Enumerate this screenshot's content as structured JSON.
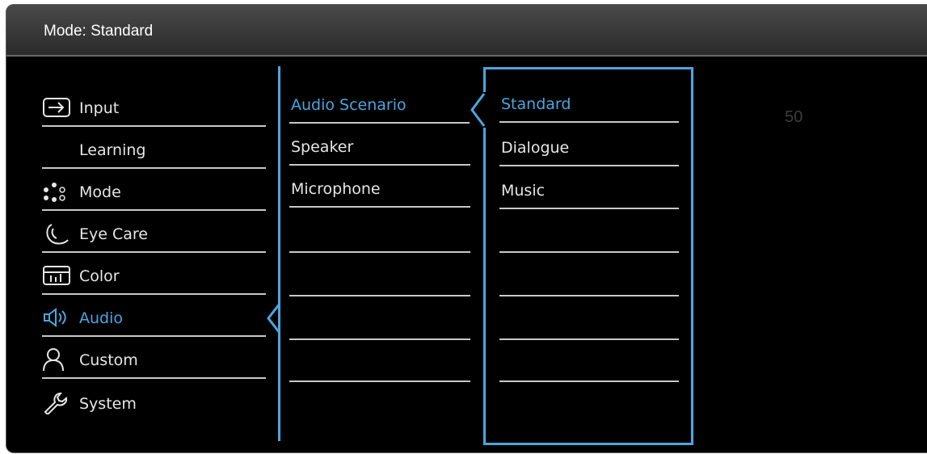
{
  "header": {
    "title": "Mode: Standard"
  },
  "menu": {
    "items": [
      {
        "label": "Input",
        "icon": "input-icon"
      },
      {
        "label": "Learning",
        "icon": ""
      },
      {
        "label": "Mode",
        "icon": "mode-icon"
      },
      {
        "label": "Eye Care",
        "icon": "eye-care-icon"
      },
      {
        "label": "Color",
        "icon": "color-icon"
      },
      {
        "label": "Audio",
        "icon": "audio-icon",
        "selected": true
      },
      {
        "label": "Custom",
        "icon": "custom-icon"
      },
      {
        "label": "System",
        "icon": "system-icon"
      }
    ]
  },
  "submenu": {
    "items": [
      {
        "label": "Audio Scenario",
        "selected": true
      },
      {
        "label": "Speaker"
      },
      {
        "label": "Microphone"
      }
    ]
  },
  "options": {
    "items": [
      {
        "label": "Standard",
        "selected": true
      },
      {
        "label": "Dialogue"
      },
      {
        "label": "Music"
      }
    ]
  },
  "value_display": "50",
  "colors": {
    "accent": "#4aa6df",
    "text": "#e6e6e6",
    "divider": "#c8c8c8",
    "background": "#000000"
  }
}
